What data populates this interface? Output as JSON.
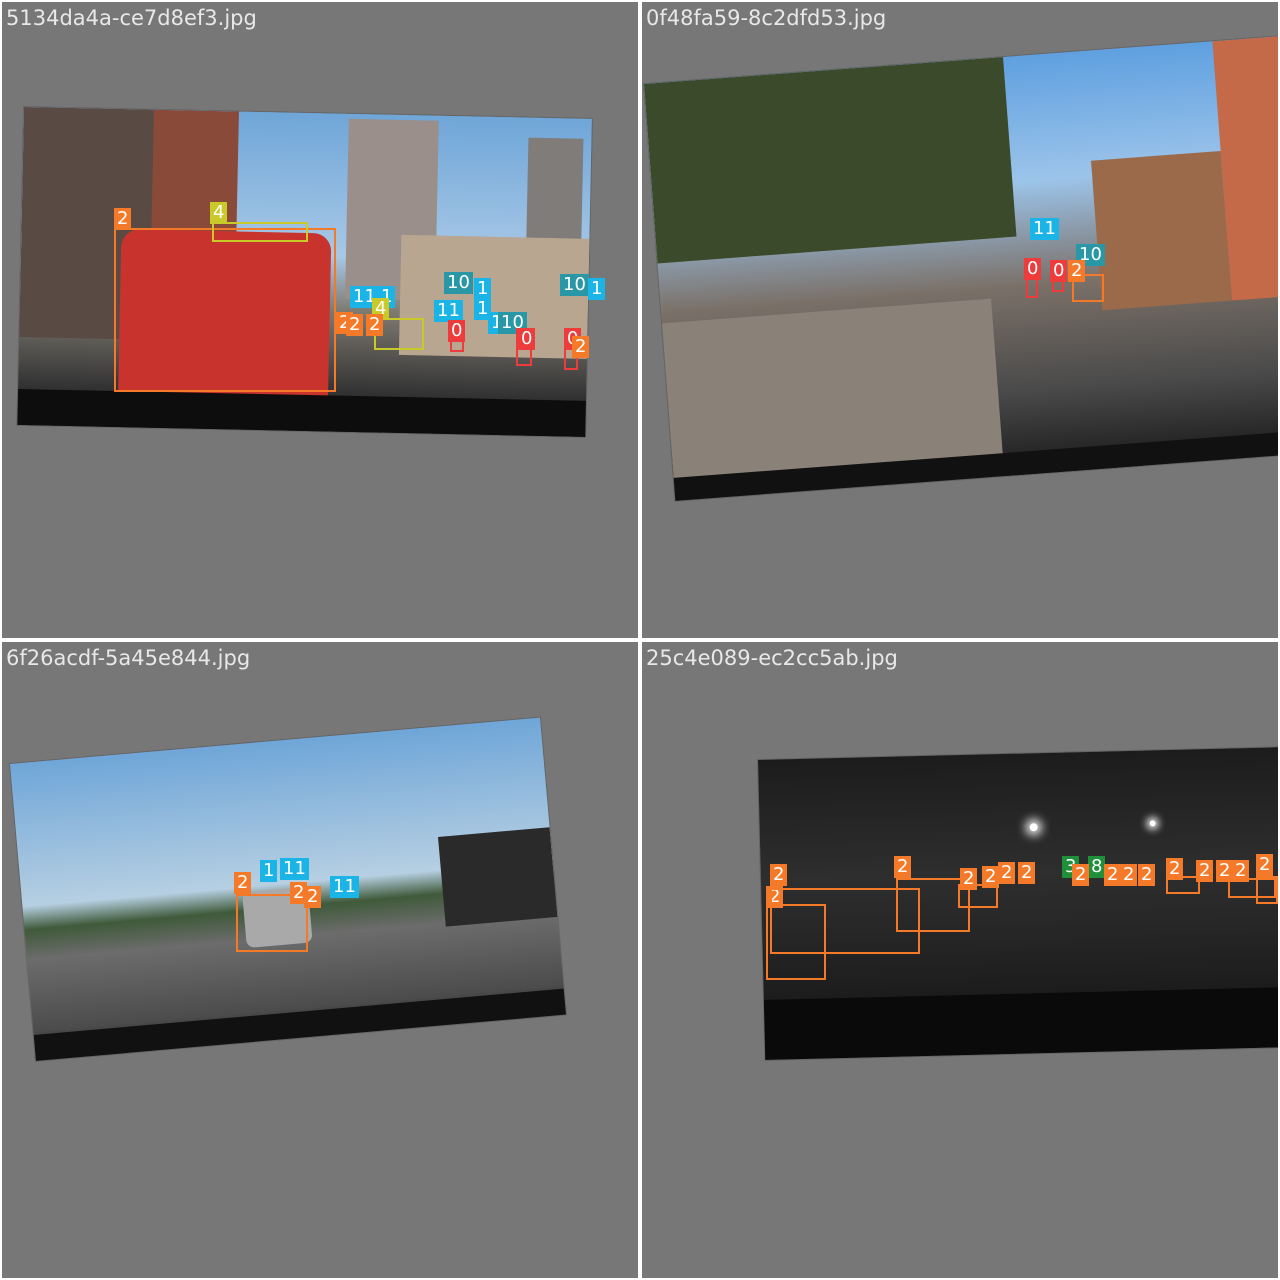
{
  "colors": {
    "background": "#777777",
    "divider": "#ffffff",
    "filename_text": "#e8e8e8",
    "class_0": "#ee3b3b",
    "class_1": "#1ab4e6",
    "class_2": "#f47a2a",
    "class_3": "#1f8f3a",
    "class_4": "#c9c92a",
    "class_8": "#1f8f3a",
    "class_10": "#2a97a6"
  },
  "tiles": [
    {
      "filename": "5134da4a-ce7d8ef3.jpg",
      "labels": [
        "2",
        "4",
        "11",
        "1",
        "10",
        "1",
        "10",
        "1",
        "4",
        "2",
        "2",
        "2",
        "11",
        "1",
        "1",
        "10",
        "0",
        "0",
        "0",
        "2"
      ]
    },
    {
      "filename": "0f48fa59-8c2dfd53.jpg",
      "labels": [
        "11",
        "10",
        "0",
        "0",
        "2"
      ]
    },
    {
      "filename": "6f26acdf-5a45e844.jpg",
      "labels": [
        "2",
        "1",
        "11",
        "2",
        "2",
        "11"
      ]
    },
    {
      "filename": "25c4e089-ec2cc5ab.jpg",
      "labels": [
        "2",
        "2",
        "2",
        "2",
        "2",
        "2",
        "3",
        "8",
        "2",
        "2",
        "2",
        "2",
        "2",
        "2",
        "2",
        "2",
        "2",
        "2"
      ]
    }
  ]
}
